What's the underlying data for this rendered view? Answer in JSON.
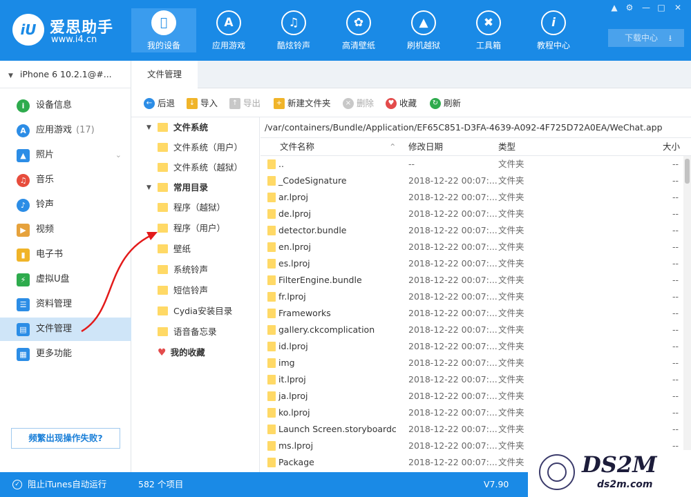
{
  "app": {
    "name": "爱思助手",
    "url": "www.i4.cn",
    "logo_text": "iU"
  },
  "nav": [
    {
      "label": "我的设备",
      "icon": "apple-icon",
      "active": true
    },
    {
      "label": "应用游戏",
      "icon": "appstore-icon"
    },
    {
      "label": "酷炫铃声",
      "icon": "bell-icon"
    },
    {
      "label": "高清壁纸",
      "icon": "flower-icon"
    },
    {
      "label": "刷机越狱",
      "icon": "box-icon"
    },
    {
      "label": "工具箱",
      "icon": "tools-icon"
    },
    {
      "label": "教程中心",
      "icon": "info-icon"
    }
  ],
  "download_center": "下载中心",
  "device": "iPhone 6 10.2.1@#...",
  "sidebar": [
    {
      "label": "设备信息",
      "color": "#2eab4d"
    },
    {
      "label": "应用游戏",
      "count": "(17)",
      "color": "#2c8de6"
    },
    {
      "label": "照片",
      "color": "#2c8de6"
    },
    {
      "label": "音乐",
      "color": "#e74c3c"
    },
    {
      "label": "铃声",
      "color": "#2c8de6"
    },
    {
      "label": "视频",
      "color": "#e6a23c"
    },
    {
      "label": "电子书",
      "color": "#f0b429"
    },
    {
      "label": "虚拟U盘",
      "color": "#2eab4d"
    },
    {
      "label": "资料管理",
      "color": "#2c8de6"
    },
    {
      "label": "文件管理",
      "color": "#2c8de6",
      "active": true
    },
    {
      "label": "更多功能",
      "color": "#2c8de6"
    }
  ],
  "help_button": "频繁出现操作失败?",
  "tab": "文件管理",
  "toolbar": {
    "back": "后退",
    "import": "导入",
    "export": "导出",
    "new_folder": "新建文件夹",
    "delete": "删除",
    "favorite": "收藏",
    "refresh": "刷新"
  },
  "tree": {
    "fs": "文件系统",
    "fs_user": "文件系统（用户）",
    "fs_jb": "文件系统（越狱）",
    "common": "常用目录",
    "app_jb": "程序（越狱）",
    "app_user": "程序（用户）",
    "wallpaper": "壁纸",
    "ringtone": "系统铃声",
    "sms": "短信铃声",
    "cydia": "Cydia安装目录",
    "memo": "语音备忘录",
    "fav": "我的收藏"
  },
  "path": "/var/containers/Bundle/Application/EF65C851-D3FA-4639-A092-4F725D72A0EA/WeChat.app",
  "columns": {
    "name": "文件名称",
    "date": "修改日期",
    "type": "类型",
    "size": "大小"
  },
  "files": [
    {
      "name": "..",
      "date": "--",
      "type": "文件夹",
      "size": "--"
    },
    {
      "name": "_CodeSignature",
      "date": "2018-12-22 00:07:...",
      "type": "文件夹",
      "size": "--"
    },
    {
      "name": "ar.lproj",
      "date": "2018-12-22 00:07:...",
      "type": "文件夹",
      "size": "--"
    },
    {
      "name": "de.lproj",
      "date": "2018-12-22 00:07:...",
      "type": "文件夹",
      "size": "--"
    },
    {
      "name": "detector.bundle",
      "date": "2018-12-22 00:07:...",
      "type": "文件夹",
      "size": "--"
    },
    {
      "name": "en.lproj",
      "date": "2018-12-22 00:07:...",
      "type": "文件夹",
      "size": "--"
    },
    {
      "name": "es.lproj",
      "date": "2018-12-22 00:07:...",
      "type": "文件夹",
      "size": "--"
    },
    {
      "name": "FilterEngine.bundle",
      "date": "2018-12-22 00:07:...",
      "type": "文件夹",
      "size": "--"
    },
    {
      "name": "fr.lproj",
      "date": "2018-12-22 00:07:...",
      "type": "文件夹",
      "size": "--"
    },
    {
      "name": "Frameworks",
      "date": "2018-12-22 00:07:...",
      "type": "文件夹",
      "size": "--"
    },
    {
      "name": "gallery.ckcomplication",
      "date": "2018-12-22 00:07:...",
      "type": "文件夹",
      "size": "--"
    },
    {
      "name": "id.lproj",
      "date": "2018-12-22 00:07:...",
      "type": "文件夹",
      "size": "--"
    },
    {
      "name": "img",
      "date": "2018-12-22 00:07:...",
      "type": "文件夹",
      "size": "--"
    },
    {
      "name": "it.lproj",
      "date": "2018-12-22 00:07:...",
      "type": "文件夹",
      "size": "--"
    },
    {
      "name": "ja.lproj",
      "date": "2018-12-22 00:07:...",
      "type": "文件夹",
      "size": "--"
    },
    {
      "name": "ko.lproj",
      "date": "2018-12-22 00:07:...",
      "type": "文件夹",
      "size": "--"
    },
    {
      "name": "Launch Screen.storyboardc",
      "date": "2018-12-22 00:07:...",
      "type": "文件夹",
      "size": "--"
    },
    {
      "name": "ms.lproj",
      "date": "2018-12-22 00:07:...",
      "type": "文件夹",
      "size": "--"
    },
    {
      "name": "Package",
      "date": "2018-12-22 00:07:...",
      "type": "文件夹",
      "size": "--"
    }
  ],
  "status": {
    "itunes": "阻止iTunes自动运行",
    "count": "582 个项目",
    "version": "V7.90"
  },
  "watermark": {
    "big": "DS2M",
    "small": "ds2m.com"
  }
}
